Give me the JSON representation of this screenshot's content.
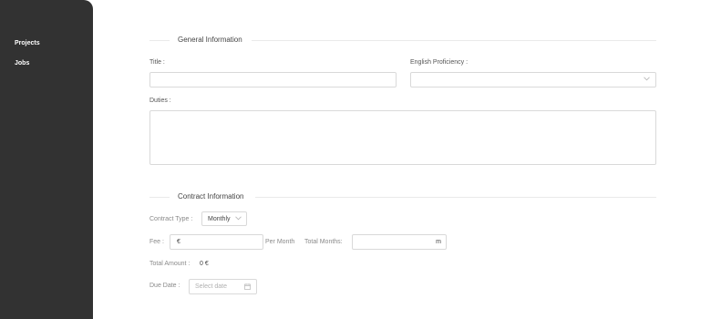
{
  "sidebar": {
    "items": [
      {
        "label": "Projects"
      },
      {
        "label": "Jobs"
      }
    ]
  },
  "general": {
    "section_title": "General Information",
    "title_label": "Title :",
    "title_value": "",
    "english_label": "English Proficiency :",
    "english_value": "",
    "duties_label": "Duties :",
    "duties_value": ""
  },
  "contract": {
    "section_title": "Contract Information",
    "type_label": "Contract Type :",
    "type_value": "Monthly",
    "fee_label": "Fee :",
    "fee_currency": "€",
    "fee_value": "",
    "per_month": "Per Month",
    "total_months_label": "Total Months:",
    "total_months_value": "",
    "total_months_unit": "m",
    "total_amount_label": "Total Amount :",
    "total_amount_value": "0 €",
    "due_date_label": "Due Date :",
    "due_date_placeholder": "Select date"
  },
  "icons": {
    "chevron": "chevron-down-icon",
    "calendar": "calendar-icon"
  }
}
